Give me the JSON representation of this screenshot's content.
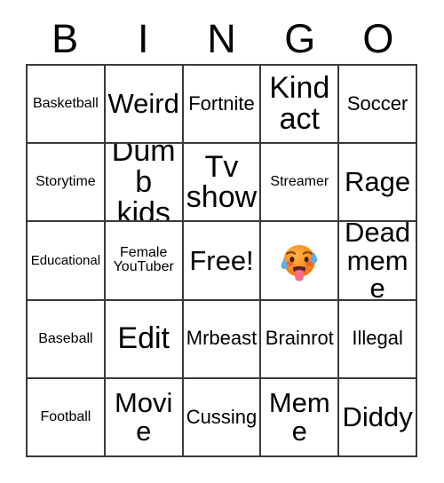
{
  "card": {
    "title_letters": [
      "B",
      "I",
      "N",
      "G",
      "O"
    ],
    "free_space_label": "Free!",
    "grid": [
      [
        {
          "label": "Basketball",
          "type": "text"
        },
        {
          "label": "Weird",
          "type": "text"
        },
        {
          "label": "Fortnite",
          "type": "text"
        },
        {
          "label": "Kind act",
          "type": "text"
        },
        {
          "label": "Soccer",
          "type": "text"
        }
      ],
      [
        {
          "label": "Storytime",
          "type": "text"
        },
        {
          "label": "Dumb kids",
          "type": "text"
        },
        {
          "label": "Tv show",
          "type": "text"
        },
        {
          "label": "Streamer",
          "type": "text"
        },
        {
          "label": "Rage",
          "type": "text"
        }
      ],
      [
        {
          "label": "Educational",
          "type": "text"
        },
        {
          "label": "Female YouTuber",
          "type": "text"
        },
        {
          "label": "Free!",
          "type": "free"
        },
        {
          "label": "🥵",
          "type": "emoji",
          "emoji_name": "hot-face-emoji"
        },
        {
          "label": "Dead meme",
          "type": "text"
        }
      ],
      [
        {
          "label": "Baseball",
          "type": "text"
        },
        {
          "label": "Edit",
          "type": "text"
        },
        {
          "label": "Mrbeast",
          "type": "text"
        },
        {
          "label": "Brainrot",
          "type": "text"
        },
        {
          "label": "Illegal",
          "type": "text"
        }
      ],
      [
        {
          "label": "Football",
          "type": "text"
        },
        {
          "label": "Movie",
          "type": "text"
        },
        {
          "label": "Cussing",
          "type": "text"
        },
        {
          "label": "Meme",
          "type": "text"
        },
        {
          "label": "Diddy",
          "type": "text"
        }
      ]
    ],
    "colors": {
      "background": "#ffffff",
      "text": "#000000",
      "border": "#3a3a3a",
      "emoji_face": "#f5821f",
      "emoji_sweat": "#5dadec",
      "emoji_tongue": "#fc6d8a"
    }
  }
}
